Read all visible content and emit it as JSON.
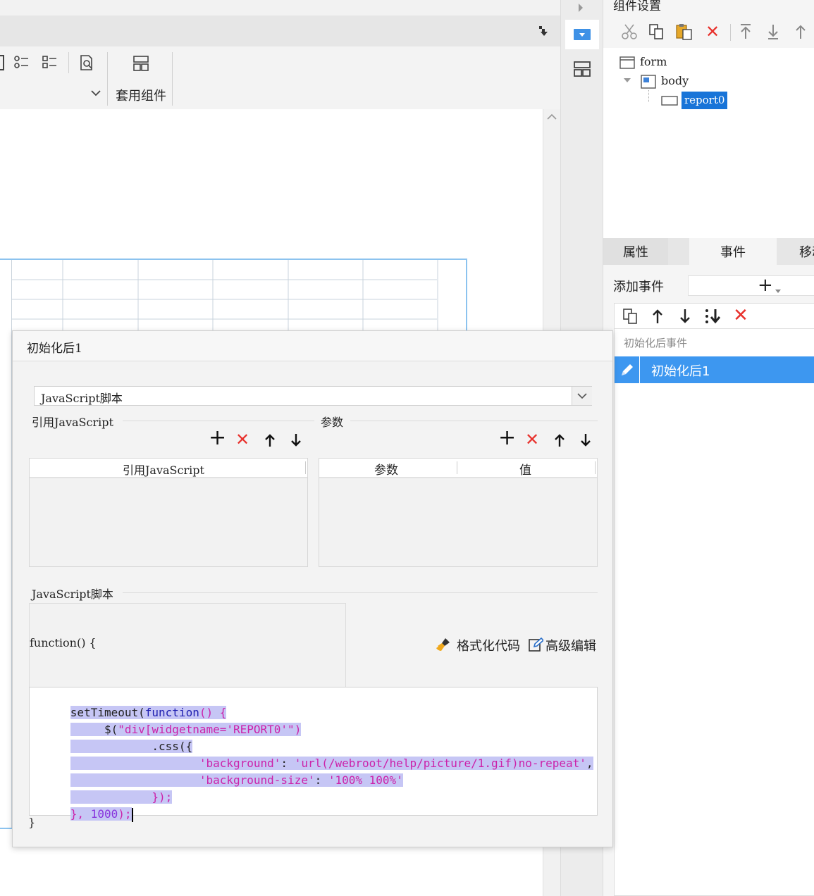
{
  "ribbon": {
    "group_label": "套用组件"
  },
  "right_panel": {
    "title": "组件设置",
    "tree": {
      "root": "form",
      "child": "body",
      "leaf": "report0"
    },
    "tabs": [
      "属性",
      "事件",
      "移动"
    ],
    "add_event_label": "添加事件",
    "event_group": "初始化后事件",
    "event_item": "初始化后1"
  },
  "dialog": {
    "title": "初始化后1",
    "script_type": "JavaScript脚本",
    "ref_section": "引用JavaScript",
    "param_section": "参数",
    "ref_column": "引用JavaScript",
    "param_columns": [
      "参数",
      "值"
    ],
    "script_section": "JavaScript脚本",
    "function_open": "function() {",
    "function_close": "}",
    "format_code": "格式化代码",
    "advanced_edit": "高级编辑",
    "code": {
      "l1_a": "setTimeout(",
      "l1_b": "function",
      "l1_c": "() {",
      "l2_a": "$(",
      "l2_b": "\"div[widgetname='REPORT0'\")",
      "l3": ".css({",
      "l4_a": "'background'",
      "l4_b": ": ",
      "l4_c": "'url(/webroot/help/picture/1.gif)no-repeat'",
      "l4_d": ",",
      "l5_a": "'background-size'",
      "l5_b": ": ",
      "l5_c": "'100% 100%'",
      "l6": "});",
      "l7_a": "}, ",
      "l7_b": "1000",
      "l7_c": ");"
    }
  }
}
